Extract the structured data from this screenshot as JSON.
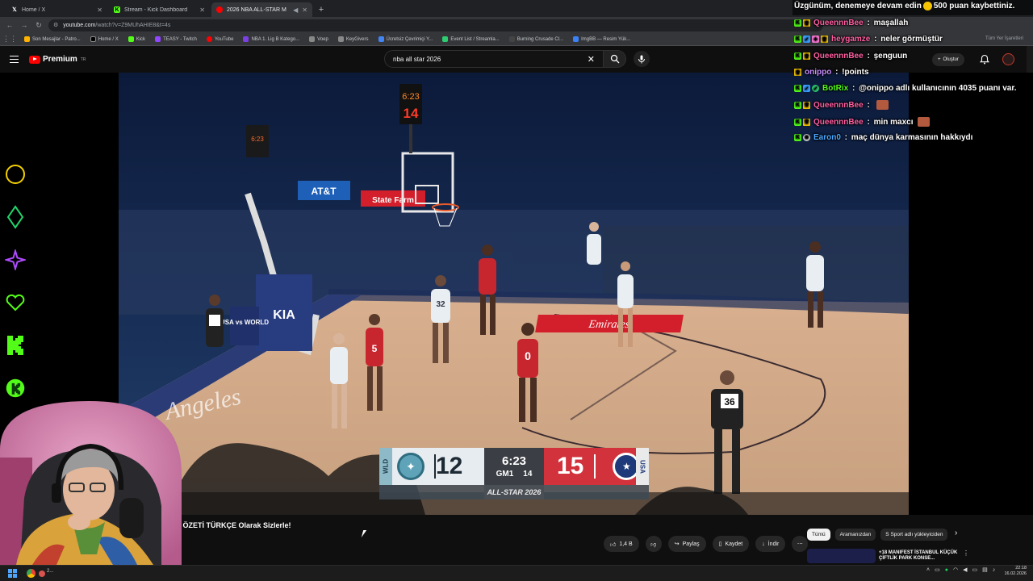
{
  "browser": {
    "tabs": [
      {
        "label": "Home / X",
        "icon": "x-logo-icon"
      },
      {
        "label": "Stream - Kick Dashboard",
        "icon": "kick-logo-icon"
      },
      {
        "label": "2026 NBA ALL-STAR M",
        "icon": "youtube-logo-icon",
        "active": true
      }
    ],
    "url_host": "youtube.com",
    "url_path": "/watch?v=Z9MUhAHIE8&t=4s",
    "bookmarks": [
      "Son Mesajlar - Patro...",
      "Home / X",
      "Kick",
      "TEASY - Twitch",
      "YouTube",
      "NBA 1. Lig B Katego...",
      "Voep",
      "KeyGivers",
      "Ücretsiz Çevrimiçi Y...",
      "Event List / Streamla...",
      "Burning Crusade Cl...",
      "ImgBB — Resim Yük..."
    ],
    "all_bookmarks": "Tüm Yer İşaretleri"
  },
  "youtube": {
    "brand": "Premium",
    "brand_sup": "TR",
    "search_value": "nba all star 2026",
    "create_label": "Oluştur",
    "video_title": "IN ÖZETİ TÜRKÇE Olarak Sizlerle!",
    "actions": {
      "likes": "1,4 B",
      "share": "Paylaş",
      "save": "Kaydet",
      "download": "İndir"
    },
    "chips": [
      "Tümü",
      "Aramanızdan",
      "S Sport adlı yükleyiciden"
    ],
    "reco_title": "+18 MANIFEST İSTANBUL KÜÇÜK ÇİFTLİK PARK KONSE..."
  },
  "scoreboard": {
    "left_team": "WLD",
    "left_score": "12",
    "clock": "6:23",
    "game": "GM1",
    "shot_clock": "14",
    "right_score": "15",
    "right_team": "USA",
    "event": "ALL-STAR 2026"
  },
  "arena": {
    "shot_clock_top": "6:23",
    "shot_clock_bottom": "14",
    "sponsor_att": "AT&T",
    "sponsor_emirates": "Emirates",
    "sponsor_kia": "KIA",
    "sponsor_statefarm": "State Farm",
    "usa_world": "USA vs WORLD",
    "referee_number": "36",
    "player_numbers": [
      "5",
      "0",
      "32"
    ]
  },
  "chat": {
    "system_message": "Üzgünüm, denemeye devam edin",
    "system_points": "500 puan kaybettiniz.",
    "messages": [
      {
        "user": "QueennnBee",
        "color": "#ff5fa2",
        "text": "maşallah",
        "badges": [
          "b-k",
          "b-crown"
        ]
      },
      {
        "user": "heygamze",
        "color": "#ff5fa2",
        "text": "neler görmüştür",
        "badges": [
          "b-k",
          "b-star",
          "b-gift",
          "b-crown"
        ]
      },
      {
        "user": "QueennnBee",
        "color": "#ff5fa2",
        "text": "şenguun",
        "badges": [
          "b-k",
          "b-crown"
        ]
      },
      {
        "user": "onippo",
        "color": "#c58cff",
        "text": "!points",
        "badges": [
          "b-crown"
        ]
      },
      {
        "user": "BotRix",
        "color": "#53fc18",
        "text": "@onippo adlı kullanıcının 4035 puanı var.",
        "badges": [
          "b-k",
          "b-star",
          "b-ok"
        ]
      },
      {
        "user": "QueennnBee",
        "color": "#ff5fa2",
        "text": "",
        "emote": true,
        "badges": [
          "b-k",
          "b-crown"
        ]
      },
      {
        "user": "QueennnBee",
        "color": "#ff5fa2",
        "text": "min maxcı",
        "emote": true,
        "badges": [
          "b-k",
          "b-crown"
        ]
      },
      {
        "user": "Earon0",
        "color": "#4aa8ff",
        "text": "maç dünya karmasının hakkıydı",
        "badges": [
          "b-bot"
        ]
      }
    ]
  },
  "kick_sidebar_icons": [
    "circle-icon",
    "diamond-icon",
    "star-icon",
    "heart-icon",
    "kick-k-icon",
    "kick-circle-icon"
  ],
  "taskbar": {
    "time": "22:18",
    "date": "16.02.2026",
    "app_label": "2..."
  },
  "colors": {
    "kick_green": "#53fc18",
    "youtube_red": "#ff0000",
    "usa_red": "#d1323b",
    "world_teal": "#5fa3b8"
  }
}
